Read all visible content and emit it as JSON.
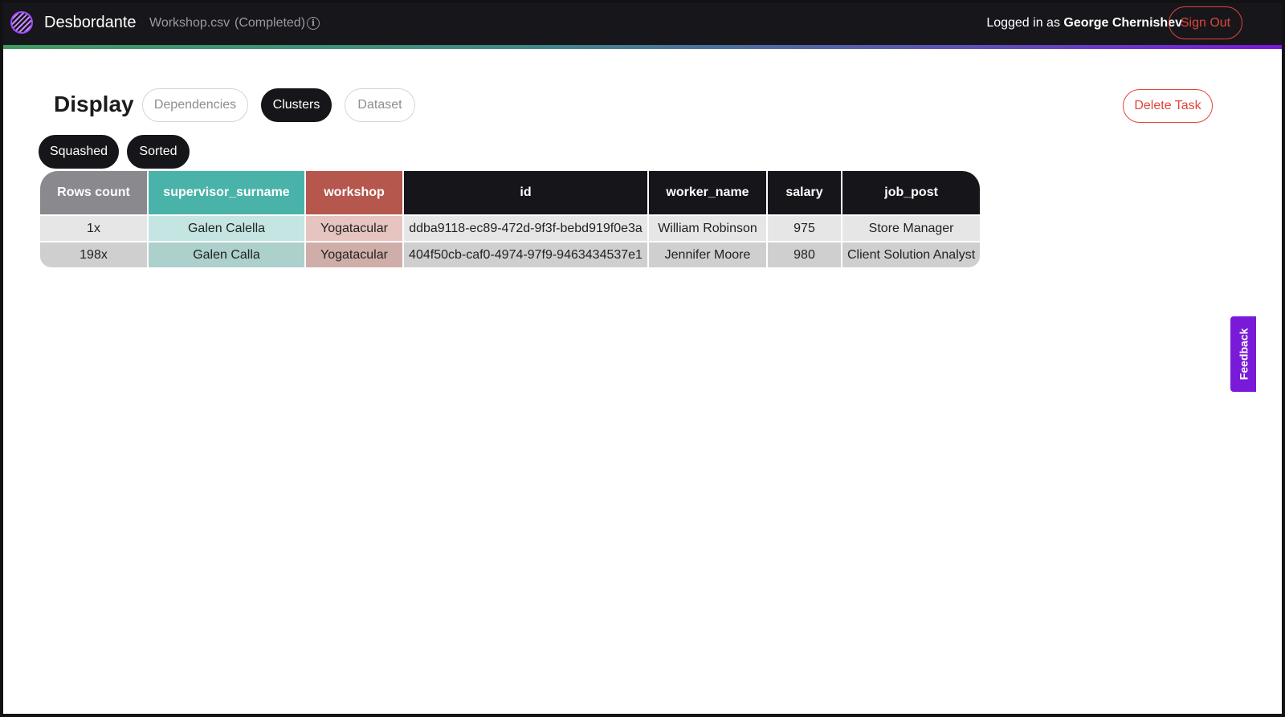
{
  "header": {
    "brand": "Desbordante",
    "file_name": "Workshop.csv",
    "file_status": "(Completed)",
    "info_icon": "info-icon",
    "logged_in_prefix": "Logged in as ",
    "user_name": "George Chernishev",
    "sign_out_label": "Sign Out",
    "gradient_colors": [
      "#3e9b62",
      "#5c52b5",
      "#7b17d8"
    ]
  },
  "display": {
    "title": "Display",
    "tabs": [
      {
        "label": "Dependencies",
        "active": false
      },
      {
        "label": "Clusters",
        "active": true
      },
      {
        "label": "Dataset",
        "active": false
      }
    ],
    "delete_label": "Delete Task",
    "view_modes": [
      {
        "label": "Squashed"
      },
      {
        "label": "Sorted"
      }
    ]
  },
  "table": {
    "columns": [
      {
        "label": "Rows count",
        "color": "#8a8a8e"
      },
      {
        "label": "supervisor_surname",
        "color": "#4ab3a9"
      },
      {
        "label": "workshop",
        "color": "#b5574d"
      },
      {
        "label": "id",
        "color": "#161519"
      },
      {
        "label": "worker_name",
        "color": "#161519"
      },
      {
        "label": "salary",
        "color": "#161519"
      },
      {
        "label": "job_post",
        "color": "#161519"
      }
    ],
    "rows": [
      [
        "1x",
        "Galen Calella",
        "Yogatacular",
        "ddba9118-ec89-472d-9f3f-bebd919f0e3a",
        "William Robinson",
        "975",
        "Store Manager"
      ],
      [
        "198x",
        "Galen Calla",
        "Yogatacular",
        "404f50cb-caf0-4974-97f9-9463434537e1",
        "Jennifer Moore",
        "980",
        "Client Solution Analyst"
      ]
    ],
    "row_colors": [
      [
        "#e6e6e6",
        "#c4e5e1",
        "#e6c4c0",
        "#e6e6e6",
        "#e6e6e6",
        "#e6e6e6",
        "#e6e6e6"
      ],
      [
        "#cfcfcf",
        "#acd0cc",
        "#cfaeaa",
        "#cfcfcf",
        "#cfcfcf",
        "#cfcfcf",
        "#cfcfcf"
      ]
    ]
  },
  "feedback_label": "Feedback"
}
